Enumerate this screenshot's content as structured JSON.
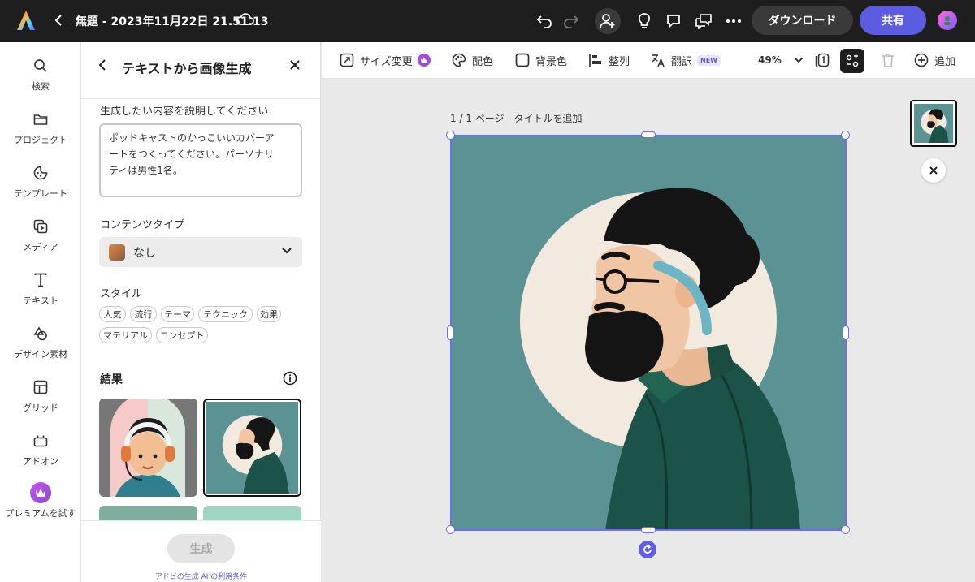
{
  "topbar": {
    "doc_title": "無題 - 2023年11月22日 21.51.13",
    "download_label": "ダウンロード",
    "share_label": "共有"
  },
  "rail": {
    "items": [
      {
        "label": "検索",
        "icon": "search-icon"
      },
      {
        "label": "プロジェクト",
        "icon": "folder-icon"
      },
      {
        "label": "テンプレート",
        "icon": "template-icon"
      },
      {
        "label": "メディア",
        "icon": "media-icon"
      },
      {
        "label": "テキスト",
        "icon": "text-icon"
      },
      {
        "label": "デザイン素材",
        "icon": "shapes-icon"
      },
      {
        "label": "グリッド",
        "icon": "grid-icon"
      },
      {
        "label": "アドオン",
        "icon": "addon-icon"
      },
      {
        "label": "プレミアムを試す",
        "icon": "crown-icon"
      }
    ]
  },
  "panel": {
    "title": "テキストから画像生成",
    "prompt_label": "生成したい内容を説明してください",
    "prompt_lines": [
      "ポッドキャストのかっこいいカバーア",
      "ートをつくってください。パーソナリ",
      "ティは男性1名。"
    ],
    "content_type_label": "コンテンツタイプ",
    "content_type_value": "なし",
    "style_label": "スタイル",
    "style_chips": [
      "人気",
      "流行",
      "テーマ",
      "テクニック",
      "効果",
      "マテリアル",
      "コンセプト"
    ],
    "results_label": "結果",
    "generate_label": "生成",
    "terms_label": "アドビの生成 AI の利用条件"
  },
  "toolbar": {
    "resize_label": "サイズ変更",
    "color_label": "配色",
    "background_label": "背景色",
    "align_label": "整列",
    "translate_label": "翻訳",
    "new_badge": "NEW",
    "zoom": "49%",
    "add_label": "追加"
  },
  "canvas": {
    "page_label": "1 / 1 ページ - タイトルを追加"
  },
  "colors": {
    "accent": "#5c5ce0",
    "artboard_bg": "#5b9294",
    "premium": "#a24bd6"
  }
}
